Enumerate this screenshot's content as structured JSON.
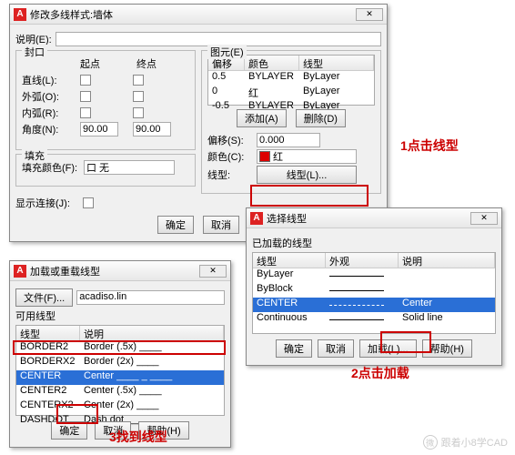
{
  "dlg1": {
    "title": "修改多线样式:墙体",
    "desc_label": "说明(E):",
    "cap_group": "封口",
    "col_start": "起点",
    "col_end": "终点",
    "rows": {
      "line": "直线(L):",
      "outer": "外弧(O):",
      "inner": "内弧(R):",
      "angle": "角度(N):"
    },
    "angle_start": "90.00",
    "angle_end": "90.00",
    "fill_group": "填充",
    "fill_color_label": "填充颜色(F):",
    "fill_color_val": "口 无",
    "show_joint": "显示连接(J):",
    "elem_group": "图元(E)",
    "hdr": {
      "off": "偏移",
      "clr": "颜色",
      "lt": "线型"
    },
    "elems": [
      {
        "off": "0.5",
        "clr": "BYLAYER",
        "lt": "ByLayer"
      },
      {
        "off": "0",
        "clr": "红",
        "lt": "ByLayer"
      },
      {
        "off": "-0.5",
        "clr": "BYLAYER",
        "lt": "ByLayer"
      }
    ],
    "add_btn": "添加(A)",
    "del_btn": "删除(D)",
    "off_label": "偏移(S):",
    "off_val": "0.000",
    "clr_label": "颜色(C):",
    "clr_val": "红",
    "lt_label": "线型:",
    "lt_btn": "线型(L)...",
    "ok": "确定",
    "cancel": "取消"
  },
  "dlg2": {
    "title": "选择线型",
    "loaded_label": "已加载的线型",
    "hdr": {
      "lt": "线型",
      "ap": "外观",
      "desc": "说明"
    },
    "rows": [
      {
        "lt": "ByLayer",
        "ap": "",
        "desc": ""
      },
      {
        "lt": "ByBlock",
        "ap": "",
        "desc": ""
      },
      {
        "lt": "CENTER",
        "ap": "",
        "desc": "Center"
      },
      {
        "lt": "Continuous",
        "ap": "",
        "desc": "Solid line"
      }
    ],
    "ok": "确定",
    "cancel": "取消",
    "load": "加载(L)...",
    "help": "帮助(H)"
  },
  "dlg3": {
    "title": "加载或重载线型",
    "file_btn": "文件(F)...",
    "file_val": "acadiso.lin",
    "avail": "可用线型",
    "hdr": {
      "lt": "线型",
      "desc": "说明"
    },
    "rows": [
      {
        "lt": "BORDER2",
        "desc": "Border (.5x) ____"
      },
      {
        "lt": "BORDERX2",
        "desc": "Border (2x) ____"
      },
      {
        "lt": "CENTER",
        "desc": "Center ____ _ ____"
      },
      {
        "lt": "CENTER2",
        "desc": "Center (.5x) ____"
      },
      {
        "lt": "CENTERX2",
        "desc": "Center (2x) ____"
      },
      {
        "lt": "DASHDOT",
        "desc": "Dash dot ____"
      }
    ],
    "ok": "确定",
    "cancel": "取消",
    "help": "帮助(H)"
  },
  "anno": {
    "a1": "1点击线型",
    "a2": "2点击加载",
    "a3": "3找到线型"
  },
  "wm": "跟着小8学CAD"
}
